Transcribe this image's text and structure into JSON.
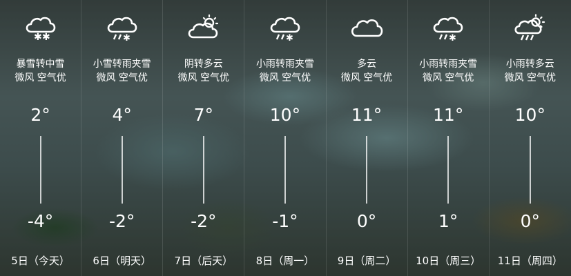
{
  "forecast": [
    {
      "icon": "cloud-snow-icon",
      "condition": "暴雪转中雪",
      "wind_air": "微风 空气优",
      "high": "2°",
      "low": "-4°",
      "date": "5日（今天）"
    },
    {
      "icon": "cloud-sleet-icon",
      "condition": "小雪转雨夹雪",
      "wind_air": "微风 空气优",
      "high": "4°",
      "low": "-2°",
      "date": "6日（明天）"
    },
    {
      "icon": "sun-cloud-icon",
      "condition": "阴转多云",
      "wind_air": "微风 空气优",
      "high": "7°",
      "low": "-2°",
      "date": "7日（后天）"
    },
    {
      "icon": "cloud-sleet-icon",
      "condition": "小雨转雨夹雪",
      "wind_air": "微风 空气优",
      "high": "10°",
      "low": "-1°",
      "date": "8日（周一）"
    },
    {
      "icon": "cloud-icon",
      "condition": "多云",
      "wind_air": "微风 空气优",
      "high": "11°",
      "low": "0°",
      "date": "9日（周二）"
    },
    {
      "icon": "cloud-sleet-icon",
      "condition": "小雨转雨夹雪",
      "wind_air": "微风 空气优",
      "high": "11°",
      "low": "1°",
      "date": "10日（周三）"
    },
    {
      "icon": "sun-cloud-rain-icon",
      "condition": "小雨转多云",
      "wind_air": "微风 空气优",
      "high": "10°",
      "low": "0°",
      "date": "11日（周四）"
    }
  ]
}
